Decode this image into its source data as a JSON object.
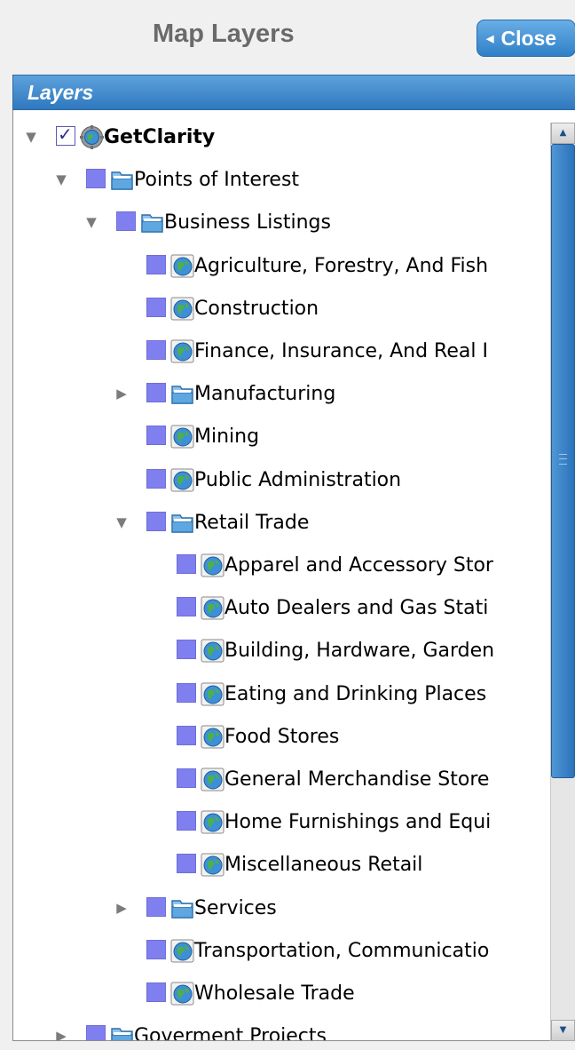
{
  "header": {
    "title": "Map Layers",
    "close_label": "Close"
  },
  "panel": {
    "title": "Layers"
  },
  "tree": [
    {
      "label": "GetClarity",
      "expander": "expanded",
      "checked": true,
      "icon": "gear-globe-icon",
      "bold": true
    },
    {
      "label": "Points of Interest",
      "expander": "expanded",
      "checked": false,
      "icon": "folder-icon"
    },
    {
      "label": "Business Listings",
      "expander": "expanded",
      "checked": false,
      "icon": "folder-icon"
    },
    {
      "label": "Agriculture, Forestry, And Fish",
      "expander": "none",
      "checked": false,
      "icon": "globe-layer-icon"
    },
    {
      "label": "Construction",
      "expander": "none",
      "checked": false,
      "icon": "globe-layer-icon"
    },
    {
      "label": "Finance, Insurance, And Real I",
      "expander": "none",
      "checked": false,
      "icon": "globe-layer-icon"
    },
    {
      "label": "Manufacturing",
      "expander": "collapsed",
      "checked": false,
      "icon": "folder-icon"
    },
    {
      "label": "Mining",
      "expander": "none",
      "checked": false,
      "icon": "globe-layer-icon"
    },
    {
      "label": "Public Administration",
      "expander": "none",
      "checked": false,
      "icon": "globe-layer-icon"
    },
    {
      "label": "Retail Trade",
      "expander": "expanded",
      "checked": false,
      "icon": "folder-icon"
    },
    {
      "label": "Apparel and Accessory Stor",
      "expander": "none",
      "checked": false,
      "icon": "globe-layer-icon"
    },
    {
      "label": "Auto Dealers and Gas Stati",
      "expander": "none",
      "checked": false,
      "icon": "globe-layer-icon"
    },
    {
      "label": "Building, Hardware, Garden",
      "expander": "none",
      "checked": false,
      "icon": "globe-layer-icon"
    },
    {
      "label": "Eating and Drinking Places",
      "expander": "none",
      "checked": false,
      "icon": "globe-layer-icon"
    },
    {
      "label": "Food Stores",
      "expander": "none",
      "checked": false,
      "icon": "globe-layer-icon"
    },
    {
      "label": "General Merchandise Store",
      "expander": "none",
      "checked": false,
      "icon": "globe-layer-icon"
    },
    {
      "label": "Home Furnishings and Equi",
      "expander": "none",
      "checked": false,
      "icon": "globe-layer-icon"
    },
    {
      "label": "Miscellaneous Retail",
      "expander": "none",
      "checked": false,
      "icon": "globe-layer-icon"
    },
    {
      "label": "Services",
      "expander": "collapsed",
      "checked": false,
      "icon": "folder-icon"
    },
    {
      "label": "Transportation, Communicatio",
      "expander": "none",
      "checked": false,
      "icon": "globe-layer-icon"
    },
    {
      "label": "Wholesale Trade",
      "expander": "none",
      "checked": false,
      "icon": "globe-layer-icon"
    },
    {
      "label": "Goverment Projects",
      "expander": "collapsed",
      "checked": false,
      "icon": "folder-icon"
    }
  ],
  "icons": {
    "expanded": "▼",
    "collapsed": "▶",
    "scroll_up": "▲",
    "scroll_down": "▼"
  },
  "colors": {
    "accent_blue": "#2f7fc7",
    "checkbox_fill": "#7f7ff0",
    "scrollbar_thumb": "#3a85c9"
  }
}
